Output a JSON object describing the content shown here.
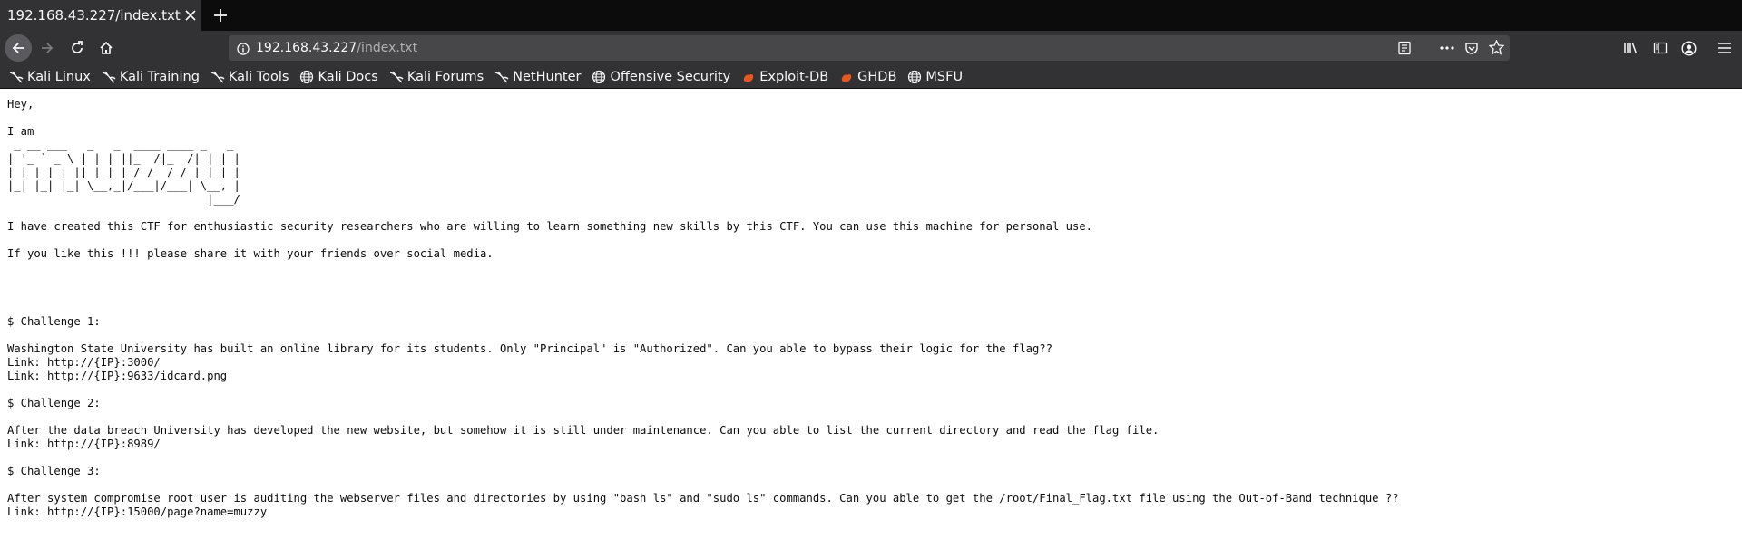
{
  "tab": {
    "title": "192.168.43.227/index.txt"
  },
  "urlbar": {
    "host": "192.168.43.227",
    "path": "/index.txt"
  },
  "bookmarks": [
    {
      "label": "Kali Linux",
      "icon": "kali-dragon-icon"
    },
    {
      "label": "Kali Training",
      "icon": "kali-dragon-icon"
    },
    {
      "label": "Kali Tools",
      "icon": "kali-dragon-icon"
    },
    {
      "label": "Kali Docs",
      "icon": "globe-icon"
    },
    {
      "label": "Kali Forums",
      "icon": "kali-dragon-icon"
    },
    {
      "label": "NetHunter",
      "icon": "kali-dragon-icon"
    },
    {
      "label": "Offensive Security",
      "icon": "globe-icon"
    },
    {
      "label": "Exploit-DB",
      "icon": "exploit-db-icon"
    },
    {
      "label": "GHDB",
      "icon": "exploit-db-icon"
    },
    {
      "label": "MSFU",
      "icon": "globe-icon"
    }
  ],
  "colors": {
    "chrome_dark": "#0c0c0d",
    "toolbar": "#323234",
    "urlbar": "#474749",
    "text_light": "#f9f9fa",
    "exploit_orange": "#e8571f"
  },
  "document": {
    "text": "Hey,\n\nI am\n _ __ ___   _   _  ____ ____ _   _\n| '_ ` _ \\ | | | ||_  /|_  /| | | |\n| | | | | || |_| | / /  / / | |_| |\n|_| |_| |_| \\__,_|/___|/___| \\__, |\n                              |___/\n\nI have created this CTF for enthusiastic security researchers who are willing to learn something new skills by this CTF. You can use this machine for personal use.\n\nIf you like this !!! please share it with your friends over social media.\n\n\n\n\n$ Challenge 1:\n\nWashington State University has built an online library for its students. Only \"Principal\" is \"Authorized\". Can you able to bypass their logic for the flag??\nLink: http://{IP}:3000/\nLink: http://{IP}:9633/idcard.png\n\n$ Challenge 2:\n\nAfter the data breach University has developed the new website, but somehow it is still under maintenance. Can you able to list the current directory and read the flag file.\nLink: http://{IP}:8989/\n\n$ Challenge 3:\n\nAfter system compromise root user is auditing the webserver files and directories by using \"bash ls\" and \"sudo ls\" commands. Can you able to get the /root/Final_Flag.txt file using the Out-of-Band technique ??\nLink: http://{IP}:15000/page?name=muzzy"
  }
}
